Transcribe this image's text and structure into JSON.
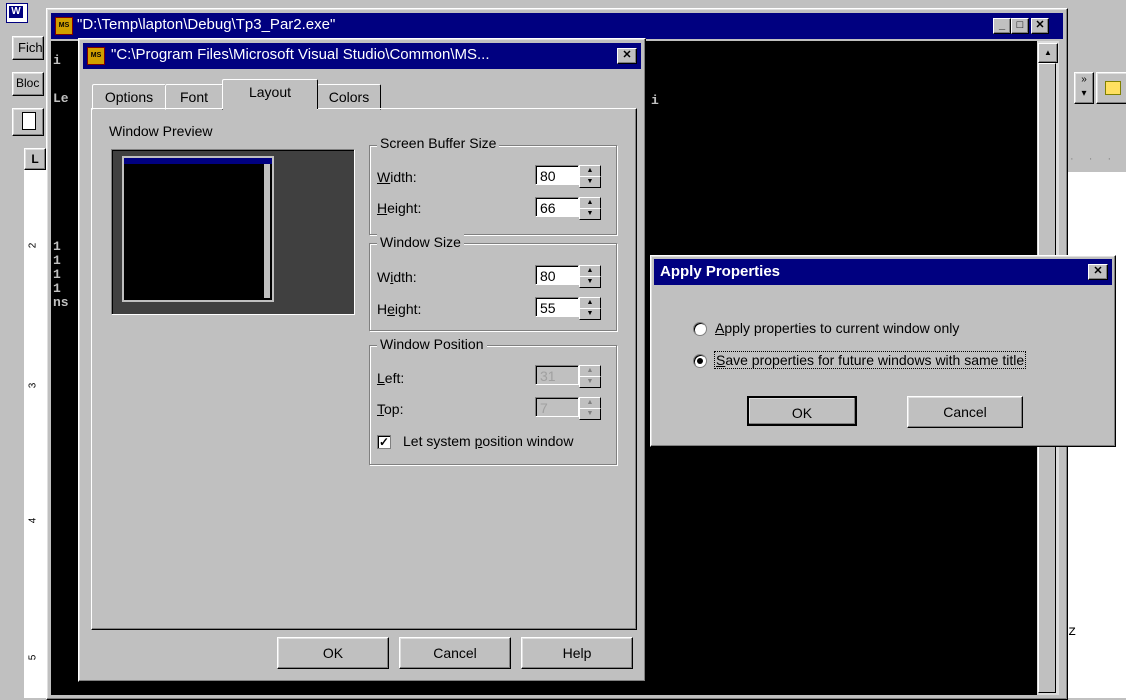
{
  "word": {
    "menu_label": "Fich",
    "style_box": "Bloc"
  },
  "console": {
    "title": "\"D:\\Temp\\lapton\\Debug\\Tp3_Par2.exe\"",
    "lines": [
      "i",
      "Le",
      "",
      "1",
      "1",
      "1",
      "1",
      "ns"
    ],
    "right_char": "i",
    "z_char": "z"
  },
  "props": {
    "title": "\"C:\\Program Files\\Microsoft Visual Studio\\Common\\MS...",
    "tabs": [
      "Options",
      "Font",
      "Layout",
      "Colors"
    ],
    "preview_label": "Window Preview",
    "buffer": {
      "title": "Screen Buffer Size",
      "width_label": "Width:",
      "width_u": "W",
      "width_rest": "idth:",
      "width_value": "80",
      "height_label": "Height:",
      "height_u": "H",
      "height_rest": "eight:",
      "height_value": "66"
    },
    "winsize": {
      "title": "Window Size",
      "width_a": "W",
      "width_u": "i",
      "width_rest": "dth:",
      "width_value": "80",
      "height_a": "H",
      "height_u": "e",
      "height_rest": "ight:",
      "height_value": "55"
    },
    "winpos": {
      "title": "Window Position",
      "left_u": "L",
      "left_rest": "eft:",
      "left_value": "31",
      "top_u": "T",
      "top_rest": "op:",
      "top_value": "7",
      "check_a": "Let system ",
      "check_u": "p",
      "check_rest": "osition window"
    },
    "buttons": {
      "ok": "OK",
      "cancel": "Cancel",
      "help": "Help"
    }
  },
  "apply": {
    "title": "Apply Properties",
    "opt1_u": "A",
    "opt1_rest": "pply properties to current window only",
    "opt2_u": "S",
    "opt2_rest": "ave properties for future windows with same title",
    "ok": "OK",
    "cancel": "Cancel"
  },
  "ruler_marks": [
    "2",
    "3",
    "4",
    "5"
  ],
  "colors": {
    "titlebar_active": "#000080",
    "console_bg": "#000000",
    "face": "#c0c0c0"
  }
}
